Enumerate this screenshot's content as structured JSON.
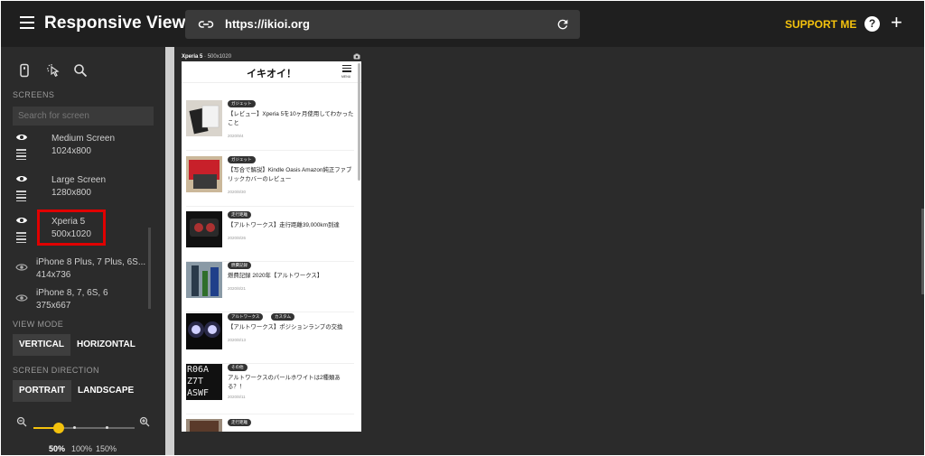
{
  "header": {
    "app_title": "Responsive Viewer",
    "url": "https://ikioi.org",
    "support_label": "SUPPORT ME",
    "help_symbol": "?",
    "plus_symbol": "+"
  },
  "sidebar": {
    "screens_heading": "SCREENS",
    "search_placeholder": "Search for screen",
    "screens": [
      {
        "name": "Medium Screen",
        "size": "1024x800"
      },
      {
        "name": "Large Screen",
        "size": "1280x800"
      },
      {
        "name": "Xperia 5",
        "size": "500x1020"
      },
      {
        "name": "iPhone 8 Plus, 7 Plus, 6S...",
        "size": "414x736"
      },
      {
        "name": "iPhone 8, 7, 6S, 6",
        "size": "375x667"
      }
    ],
    "view_mode_heading": "VIEW MODE",
    "view_mode": [
      "VERTICAL",
      "HORIZONTAL"
    ],
    "direction_heading": "SCREEN DIRECTION",
    "direction": [
      "PORTRAIT",
      "LANDSCAPE"
    ],
    "zoom_levels": [
      "50%",
      "100%",
      "150%"
    ],
    "zoom_value_percent": 50
  },
  "device": {
    "label_name": "Xperia 5",
    "label_size": "500x1020",
    "site_title": "イキオイ！",
    "menu_label": "MENU",
    "articles": [
      {
        "tags": [
          "ガジェット"
        ],
        "title": "【レビュー】Xperia 5を10ヶ月使用してわかったこと",
        "date": "2020/9/4"
      },
      {
        "tags": [
          "ガジェット"
        ],
        "title": "【写合で解説】Kindle Oasis Amazon純正ファブリックカバーのレビュー",
        "date": "2020/8/30"
      },
      {
        "tags": [
          "走行距離"
        ],
        "title": "【アルトワークス】走行距離39,000km到達",
        "date": "2020/8/26"
      },
      {
        "tags": [
          "燃費記録"
        ],
        "title": "燃費記録 2020年【アルトワークス】",
        "date": "2020/8/21"
      },
      {
        "tags": [
          "アルトワークス",
          "カスタム"
        ],
        "title": "【アルトワークス】ポジションランプの交換",
        "date": "2020/8/13"
      },
      {
        "tags": [
          "その他"
        ],
        "title": "アルトワークスのパールホワイトは2種類ある？！",
        "date": "2020/8/11"
      },
      {
        "tags": [
          "走行距離"
        ],
        "title": "",
        "date": ""
      }
    ],
    "thumb_text_lines": [
      "R06A",
      "Z7T",
      "ASWF"
    ]
  }
}
